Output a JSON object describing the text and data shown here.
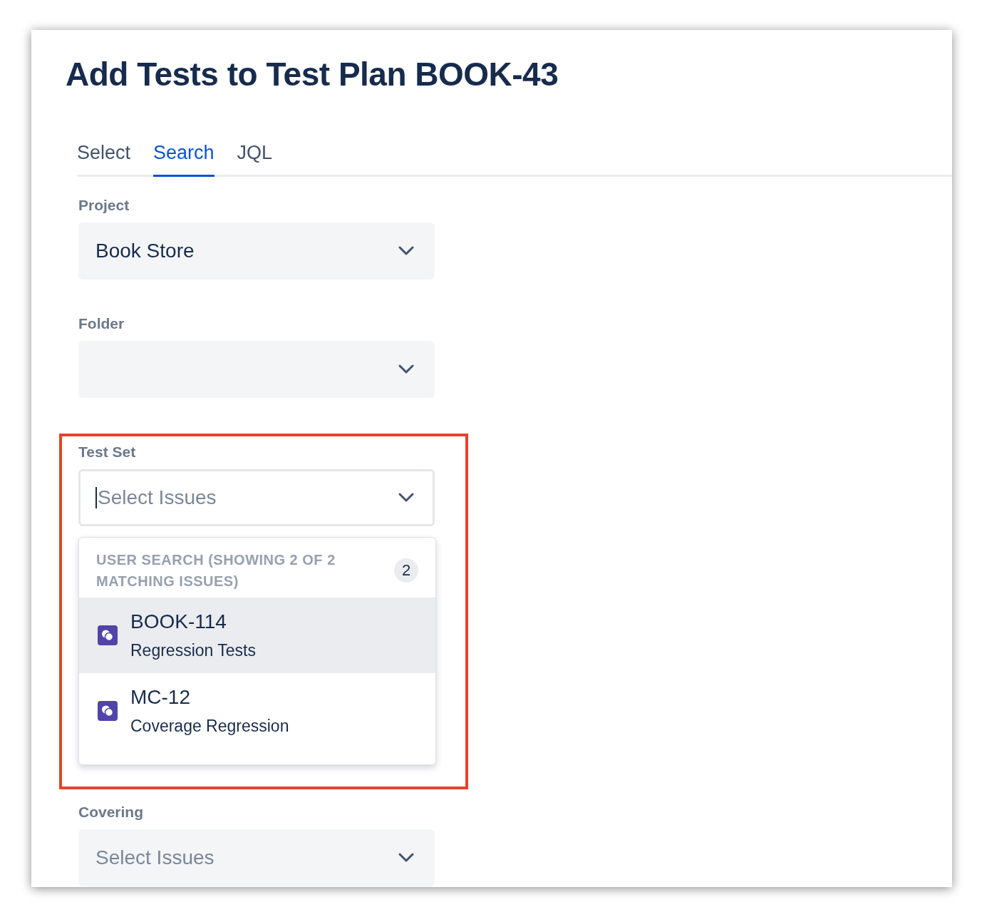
{
  "dialog": {
    "title": "Add Tests to Test Plan BOOK-43"
  },
  "tabs": [
    {
      "label": "Select",
      "selected": false
    },
    {
      "label": "Search",
      "selected": true
    },
    {
      "label": "JQL",
      "selected": false
    }
  ],
  "fields": [
    {
      "label": "Project",
      "value": "Book Store",
      "focused": false,
      "highlighted": false
    },
    {
      "label": "Folder",
      "focused": false,
      "highlighted": false
    },
    {
      "label": "Test Set",
      "placeholder": "Select Issues",
      "focused": true,
      "highlighted": true,
      "menu": {
        "heading": "USER SEARCH (SHOWING 2 OF 2 MATCHING ISSUES)",
        "count": "2",
        "options": [
          {
            "key": "BOOK-114",
            "summary": "Regression Tests",
            "selected": true
          },
          {
            "key": "MC-12",
            "summary": "Coverage Regression",
            "selected": false
          }
        ]
      }
    },
    {
      "label": "Covering",
      "placeholder": "Select Issues",
      "focused": false,
      "highlighted": false
    }
  ]
}
